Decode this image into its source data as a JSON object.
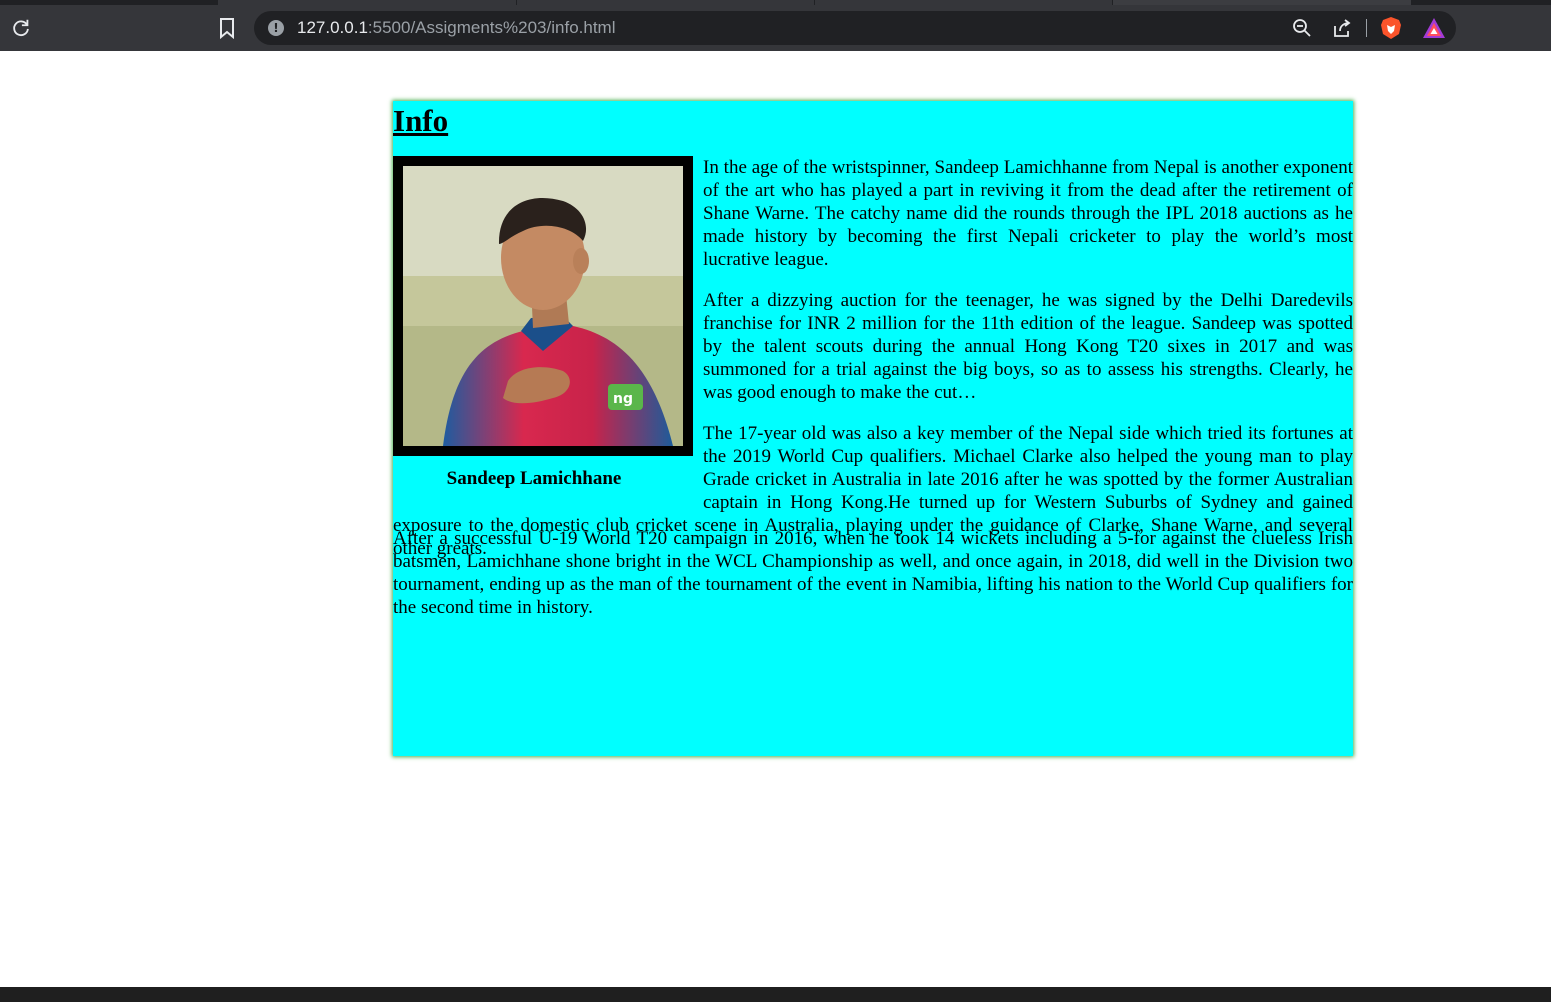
{
  "browser": {
    "url_host": "127.0.0.1",
    "url_path": ":5500/Assigments%203/info.html"
  },
  "page": {
    "heading": "Info",
    "image_alt": "Sandeep Lamichhane",
    "caption": "Sandeep Lamichhane",
    "paragraphs": [
      "In the age of the wristspinner, Sandeep Lamichhanne from Nepal is another exponent of the art who has played a part in reviving it from the dead after the retirement of Shane Warne. The catchy name did the rounds through the IPL 2018 auctions as he made history by becoming the first Nepali cricketer to play the world’s most lucrative league.",
      "After a dizzying auction for the teenager, he was signed by the Delhi Daredevils franchise for INR 2 million for the 11th edition of the league. Sandeep was spotted by the talent scouts during the annual Hong Kong T20 sixes in 2017 and was summoned for a trial against the big boys, so as to assess his strengths. Clearly, he was good enough to make the cut…",
      "The 17-year old was also a key member of the Nepal side which tried its fortunes at the 2019 World Cup qualifiers. Michael Clarke also helped the young man to play Grade cricket in Australia in late 2016 after he was spotted by the former Australian captain in Hong Kong.He turned up for Western Suburbs of Sydney and gained exposure to the domestic club cricket scene in Australia, playing under the guidance of Clarke, Shane Warne, and several other greats.",
      "After a successful U-19 World T20 campaign in 2016, when he took 14 wickets including a 5-for against the clueless Irish batsmen, Lamichhane shone bright in the WCL Championship as well, and once again, in 2018, did well in the Division two tournament, ending up as the man of the tournament of the event in Namibia, lifting his nation to the World Cup qualifiers for the second time in history."
    ]
  },
  "colors": {
    "card_background": "#00ffff",
    "card_glow": "#4caf50",
    "chrome_toolbar": "#35363a",
    "omnibox": "#202124"
  },
  "icons": [
    "reload-icon",
    "bookmark-icon",
    "site-info-icon",
    "zoom-out-icon",
    "share-icon",
    "brave-shield-icon",
    "brave-rewards-icon"
  ]
}
